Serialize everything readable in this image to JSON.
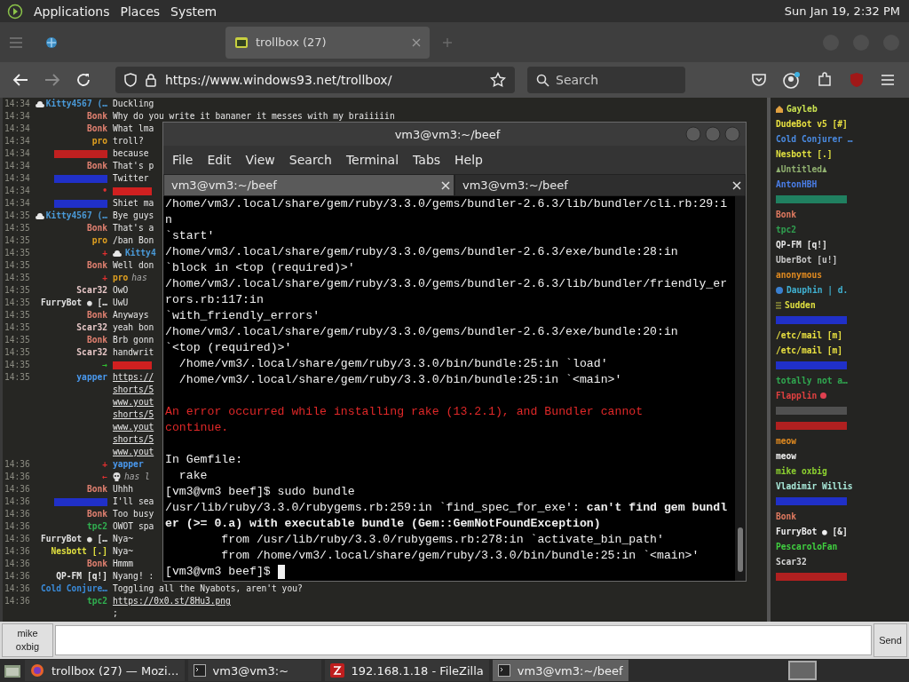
{
  "top_panel": {
    "menus": [
      "Applications",
      "Places",
      "System"
    ],
    "clock": "Sun Jan 19,  2:32 PM"
  },
  "browser": {
    "tabs": [
      {
        "selected": false
      },
      {
        "title": "trollbox (27)",
        "selected": true
      }
    ],
    "url": "https://www.windows93.net/trollbox/",
    "search": {
      "placeholder": "Search"
    }
  },
  "chat": [
    {
      "kind": "cloud",
      "time": "14:34",
      "nick": "Kitty4567 (…",
      "color": "#4a9ad8",
      "lines": [
        "Duckling"
      ],
      "link": false
    },
    {
      "kind": "msg",
      "time": "14:34",
      "nick": "Bonk",
      "color": "#e08070",
      "lines": [
        "Why do you write it bananer it messes with my braiiiiin"
      ],
      "link": false
    },
    {
      "kind": "msg",
      "time": "14:34",
      "nick": "Bonk",
      "color": "#e08070",
      "lines": [
        "What lma"
      ],
      "link": false
    },
    {
      "kind": "msg",
      "time": "14:34",
      "nick": "pro",
      "color": "#e0a020",
      "lines": [
        "troll?"
      ],
      "link": false
    },
    {
      "kind": "hidden",
      "time": "14:34",
      "color": "#c02020",
      "lines": [
        "because"
      ],
      "link": false
    },
    {
      "kind": "msg",
      "time": "14:34",
      "nick": "Bonk",
      "color": "#e08070",
      "lines": [
        "That's p"
      ],
      "link": false
    },
    {
      "kind": "hidden",
      "time": "14:34",
      "color": "#2030c8",
      "lines": [
        "Twitter"
      ],
      "link": false
    },
    {
      "kind": "event",
      "time": "14:34",
      "symbol": {
        "text": "•",
        "color": "#e03030"
      },
      "target": {
        "color": "#d02020"
      }
    },
    {
      "kind": "hidden",
      "time": "14:34",
      "color": "#2030c8",
      "lines": [
        "Shiet ma"
      ],
      "link": false
    },
    {
      "kind": "cloud",
      "time": "14:35",
      "nick": "Kitty4567 (…",
      "color": "#4a9ad8",
      "lines": [
        "Bye guys"
      ],
      "link": false
    },
    {
      "kind": "msg",
      "time": "14:35",
      "nick": "Bonk",
      "color": "#e08070",
      "lines": [
        "That's a"
      ],
      "link": false
    },
    {
      "kind": "msg",
      "time": "14:35",
      "nick": "pro",
      "color": "#e0a020",
      "lines": [
        "/ban Bon"
      ],
      "link": false
    },
    {
      "kind": "cloudevent",
      "time": "14:35",
      "symbol": {
        "text": "+",
        "color": "#e03030"
      },
      "user": {
        "name": "Kitty4",
        "color": "#4a9ad8"
      }
    },
    {
      "kind": "msg",
      "time": "14:35",
      "nick": "Bonk",
      "color": "#e08070",
      "lines": [
        "Well don"
      ],
      "link": false
    },
    {
      "kind": "event",
      "time": "14:35",
      "symbol": {
        "text": "+",
        "color": "#e03030"
      },
      "user": {
        "name": "pro",
        "color": "#e0a020"
      },
      "action": "has"
    },
    {
      "kind": "msg",
      "time": "14:35",
      "nick": "Scar32",
      "color": "#e8c8c8",
      "lines": [
        "OwO"
      ],
      "link": false
    },
    {
      "kind": "msg",
      "time": "14:35",
      "nick": "FurryBot ● […",
      "color": "#e0e0e0",
      "lines": [
        "UwU"
      ],
      "link": false
    },
    {
      "kind": "msg",
      "time": "14:35",
      "nick": "Bonk",
      "color": "#e08070",
      "lines": [
        "Anyways"
      ],
      "link": false
    },
    {
      "kind": "msg",
      "time": "14:35",
      "nick": "Scar32",
      "color": "#e8c8c8",
      "lines": [
        "yeah bon"
      ],
      "link": false
    },
    {
      "kind": "msg",
      "time": "14:35",
      "nick": "Bonk",
      "color": "#e08070",
      "lines": [
        "Brb gonn"
      ],
      "link": false
    },
    {
      "kind": "msg",
      "time": "14:35",
      "nick": "Scar32",
      "color": "#e8c8c8",
      "lines": [
        "handwrit"
      ],
      "link": false
    },
    {
      "kind": "event",
      "time": "14:35",
      "symbol": {
        "text": "→",
        "color": "#30c030"
      },
      "target": {
        "color": "#d02020"
      }
    },
    {
      "kind": "msg",
      "time": "14:35",
      "nick": "yapper",
      "color": "#4a9af0",
      "lines": [
        "https://",
        "shorts/5",
        "www.yout",
        "shorts/5",
        "www.yout",
        "shorts/5",
        "www.yout"
      ],
      "link": true
    },
    {
      "kind": "event",
      "time": "14:36",
      "symbol": {
        "text": "+",
        "color": "#e03030"
      },
      "user": {
        "name": "yapper",
        "color": "#4a9af0"
      }
    },
    {
      "kind": "skullevent",
      "time": "14:36",
      "symbol": {
        "text": "←",
        "color": "#e03030"
      },
      "action": "has l"
    },
    {
      "kind": "msg",
      "time": "14:36",
      "nick": "Bonk",
      "color": "#e08070",
      "lines": [
        "Uhhh"
      ],
      "link": false
    },
    {
      "kind": "hidden",
      "time": "14:36",
      "color": "#2030c8",
      "lines": [
        "I'll sea"
      ],
      "link": false
    },
    {
      "kind": "msg",
      "time": "14:36",
      "nick": "Bonk",
      "color": "#e08070",
      "lines": [
        "Too busy"
      ],
      "link": false
    },
    {
      "kind": "msg",
      "time": "14:36",
      "nick": "tpc2",
      "color": "#30b050",
      "lines": [
        "OWOT spa"
      ],
      "link": false
    },
    {
      "kind": "msg",
      "time": "14:36",
      "nick": "FurryBot ● […",
      "color": "#e0e0e0",
      "lines": [
        "Nya~"
      ],
      "link": false
    },
    {
      "kind": "msg",
      "time": "14:36",
      "nick": "Nesbott [.]",
      "color": "#e0e040",
      "lines": [
        "Nya~"
      ],
      "link": false
    },
    {
      "kind": "msg",
      "time": "14:36",
      "nick": "Bonk",
      "color": "#e08070",
      "lines": [
        "Hmmm"
      ],
      "link": false
    },
    {
      "kind": "msg",
      "time": "14:36",
      "nick": "QP-FM [q!]",
      "color": "#e8e8e8",
      "lines": [
        "Nyang! :"
      ],
      "link": false
    },
    {
      "kind": "msg",
      "time": "14:36",
      "nick": "Cold Conjure…",
      "color": "#3a8ad8",
      "lines": [
        "Toggling all the Nyabots, aren't you?"
      ],
      "link": false
    },
    {
      "kind": "msg",
      "time": "14:36",
      "nick": "tpc2",
      "color": "#30b050",
      "lines": [
        "https://0x0.st/8Hu3.png",
        ";"
      ],
      "link": true
    }
  ],
  "users": [
    {
      "kind": "house",
      "name": "Gayleb",
      "color": "#c8e050"
    },
    {
      "kind": "plain",
      "name": "DudeBot v5 [#]",
      "color": "#e8e040"
    },
    {
      "kind": "plain",
      "name": "Cold Conjurer …",
      "color": "#4a8ae0"
    },
    {
      "kind": "plain",
      "name": "Nesbott [.]",
      "color": "#e0e040"
    },
    {
      "kind": "plain",
      "name": "♟Untitled♟",
      "color": "#90b070"
    },
    {
      "kind": "plain",
      "name": "AntonHBH",
      "color": "#4a7ee8"
    },
    {
      "kind": "hidden",
      "color": "#208060"
    },
    {
      "kind": "plain",
      "name": "Bonk",
      "color": "#e07a60"
    },
    {
      "kind": "plain",
      "name": "tpc2",
      "color": "#30a050"
    },
    {
      "kind": "plain",
      "name": "QP-FM [q!]",
      "color": "#e8e8e8"
    },
    {
      "kind": "plain",
      "name": "UberBot [u!]",
      "color": "#c8c8c8"
    },
    {
      "kind": "plain",
      "name": "anonymous",
      "color": "#e08a20"
    },
    {
      "kind": "globe",
      "name": "Dauphin | d.",
      "color": "#40b0d0"
    },
    {
      "kind": "bars",
      "name": "Sudden",
      "color": "#e0e040"
    },
    {
      "kind": "hidden",
      "color": "#2030c8"
    },
    {
      "kind": "plain",
      "name": "/etc/mail [m]",
      "color": "#e8e040"
    },
    {
      "kind": "plain",
      "name": "/etc/mail [m]",
      "color": "#e8e040"
    },
    {
      "kind": "hidden",
      "color": "#2030c8"
    },
    {
      "kind": "plain",
      "name": "totally not a…",
      "color": "#30a850"
    },
    {
      "kind": "dot",
      "name": "Flapplin",
      "color": "#e04040"
    },
    {
      "kind": "hidden",
      "color": "#505050"
    },
    {
      "kind": "hidden",
      "color": "#b02020"
    },
    {
      "kind": "plain",
      "name": "meow",
      "color": "#e08a20"
    },
    {
      "kind": "plain",
      "name": "meow",
      "color": "#f0f0f0"
    },
    {
      "kind": "plain",
      "name": "mike oxbig",
      "color": "#8cd030"
    },
    {
      "kind": "plain",
      "name": "Vladimir Willis",
      "color": "#a8e8d8"
    },
    {
      "kind": "hidden",
      "color": "#2030c8"
    },
    {
      "kind": "plain",
      "name": "Bonk",
      "color": "#e07a60"
    },
    {
      "kind": "plain",
      "name": "FurryBot ● [&]",
      "color": "#f0f0f0"
    },
    {
      "kind": "plain",
      "name": "PescaroloFan",
      "color": "#40d040"
    },
    {
      "kind": "plain",
      "name": "Scar32",
      "color": "#d8d8d8"
    },
    {
      "kind": "hidden",
      "color": "#b02020"
    }
  ],
  "terminal": {
    "title": "vm3@vm3:~/beef",
    "menus": [
      "File",
      "Edit",
      "View",
      "Search",
      "Terminal",
      "Tabs",
      "Help"
    ],
    "tabs": [
      {
        "label": "vm3@vm3:~/beef",
        "selected": true
      },
      {
        "label": "vm3@vm3:~/beef",
        "selected": false
      }
    ],
    "blocks": [
      [
        {
          "kind": "normal",
          "text": "/home/vm3/.local/share/gem/ruby/3.3.0/gems/bundler-2.6.3/lib/bundler/cli.rb:29:i"
        },
        {
          "kind": "normal",
          "text": "n"
        },
        {
          "kind": "normal",
          "text": "`start'"
        },
        {
          "kind": "normal",
          "text": "/home/vm3/.local/share/gem/ruby/3.3.0/gems/bundler-2.6.3/exe/bundle:28:in"
        },
        {
          "kind": "normal",
          "text": "`block in <top (required)>'"
        },
        {
          "kind": "normal",
          "text": "/home/vm3/.local/share/gem/ruby/3.3.0/gems/bundler-2.6.3/lib/bundler/friendly_er"
        },
        {
          "kind": "normal",
          "text": "rors.rb:117:in"
        },
        {
          "kind": "normal",
          "text": "`with_friendly_errors'"
        },
        {
          "kind": "normal",
          "text": "/home/vm3/.local/share/gem/ruby/3.3.0/gems/bundler-2.6.3/exe/bundle:20:in"
        },
        {
          "kind": "normal",
          "text": "`<top (required)>'"
        },
        {
          "kind": "normal",
          "text": "  /home/vm3/.local/share/gem/ruby/3.3.0/bin/bundle:25:in `load'"
        },
        {
          "kind": "normal",
          "text": "  /home/vm3/.local/share/gem/ruby/3.3.0/bin/bundle:25:in `<main>'"
        }
      ],
      [
        {
          "kind": "error",
          "text": "An error occurred while installing rake (13.2.1), and Bundler cannot"
        },
        {
          "kind": "error",
          "text": "continue."
        }
      ],
      [
        {
          "kind": "normal",
          "text": "In Gemfile:"
        },
        {
          "kind": "normal",
          "text": "  rake"
        },
        {
          "kind": "normal",
          "text": "[vm3@vm3 beef]$ sudo bundle"
        },
        {
          "kind": "normal",
          "text": "/usr/lib/ruby/3.3.0/rubygems.rb:259:in `find_spec_for_exe': **can't find gem bundl**"
        },
        {
          "kind": "normal",
          "text": "**er (>= 0.a) with executable bundle (Gem::GemNotFoundException)**"
        },
        {
          "kind": "normal",
          "text": "        from /usr/lib/ruby/3.3.0/rubygems.rb:278:in `activate_bin_path'"
        },
        {
          "kind": "normal",
          "text": "        from /home/vm3/.local/share/gem/ruby/3.3.0/bin/bundle:25:in `<main>'"
        },
        {
          "kind": "prompt",
          "text": "[vm3@vm3 beef]$ "
        }
      ]
    ]
  },
  "composer": {
    "nick_button": "mike oxbig",
    "send": "Send"
  },
  "taskbar": [
    {
      "kind": "firefox",
      "label": "trollbox (27) — Mozi…",
      "selected": false
    },
    {
      "kind": "terminal",
      "label": "vm3@vm3:~",
      "selected": false
    },
    {
      "kind": "filezilla",
      "label": "192.168.1.18 - FileZilla",
      "selected": false
    },
    {
      "kind": "terminal",
      "label": "vm3@vm3:~/beef",
      "selected": true
    }
  ]
}
